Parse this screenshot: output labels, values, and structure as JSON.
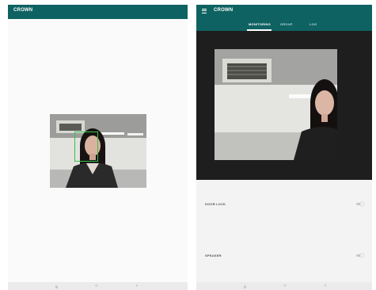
{
  "left_screen": {
    "app_title": "CROWN"
  },
  "right_screen": {
    "app_title": "CROWN",
    "tabs": [
      {
        "label": "MONITORING",
        "active": true
      },
      {
        "label": "GROUP",
        "active": false
      },
      {
        "label": "LOG",
        "active": false
      }
    ],
    "settings": [
      {
        "label": "DOOR LOCK",
        "enabled": false
      },
      {
        "label": "SPEAKER",
        "enabled": false
      }
    ]
  },
  "navigation": {
    "recent_glyph": "|||",
    "home_glyph": "○",
    "back_glyph": "‹"
  },
  "colors": {
    "app_bar": "#0f6262",
    "face_detection_box": "#35c24a"
  },
  "icons": [
    "menu-icon",
    "recent-apps-icon",
    "home-icon",
    "back-icon"
  ]
}
